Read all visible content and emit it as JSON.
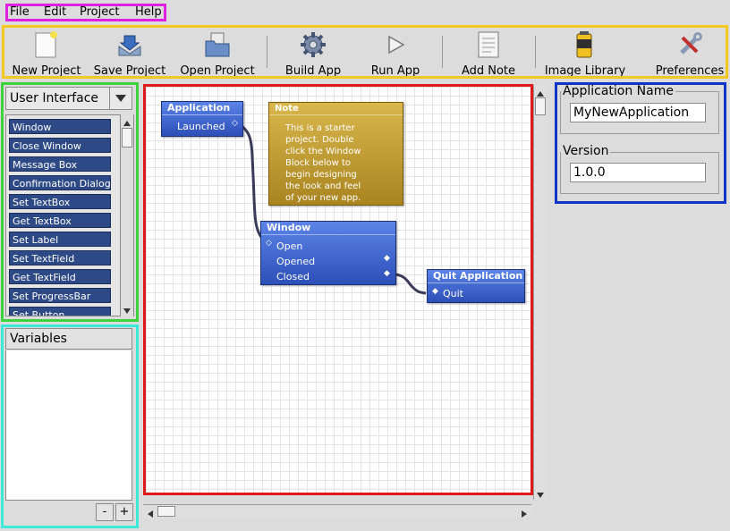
{
  "menu": {
    "items": [
      "File",
      "Edit",
      "Project",
      "Help"
    ]
  },
  "toolbar": {
    "items": [
      {
        "label": "New Project",
        "icon": "new-project-icon"
      },
      {
        "label": "Save Project",
        "icon": "save-project-icon"
      },
      {
        "label": "Open Project",
        "icon": "open-project-icon"
      },
      {
        "label": "Build App",
        "icon": "gear-icon"
      },
      {
        "label": "Run App",
        "icon": "play-icon"
      },
      {
        "label": "Add Note",
        "icon": "note-icon"
      },
      {
        "label": "Image Library",
        "icon": "film-canister-icon"
      },
      {
        "label": "Preferences",
        "icon": "tools-icon"
      }
    ]
  },
  "palette": {
    "selected": "User Interface",
    "items": [
      "Window",
      "Close Window",
      "Message Box",
      "Confirmation Dialog",
      "Set TextBox",
      "Get TextBox",
      "Set Label",
      "Set TextField",
      "Get TextField",
      "Set ProgressBar",
      "Set Button"
    ]
  },
  "variables": {
    "title": "Variables",
    "remove_label": "-",
    "add_label": "+"
  },
  "canvas": {
    "application_block": {
      "title": "Application",
      "ports": [
        "Launched"
      ]
    },
    "note": {
      "title": "Note",
      "text": "This is a starter\nproject.  Double\nclick the Window\nBlock below to\nbegin designing\nthe look and feel\nof your new app."
    },
    "window_block": {
      "title": "Window",
      "ports": [
        "Open",
        "Opened",
        "Closed"
      ]
    },
    "quit_block": {
      "title": "Quit Application",
      "ports": [
        "Quit"
      ]
    },
    "colors": {
      "block": "#3a60d0",
      "note": "#c09a30",
      "grid": "#e4e4e4"
    }
  },
  "properties": {
    "app_name_label": "Application Name",
    "app_name_value": "MyNewApplication",
    "version_label": "Version",
    "version_value": "1.0.0"
  }
}
